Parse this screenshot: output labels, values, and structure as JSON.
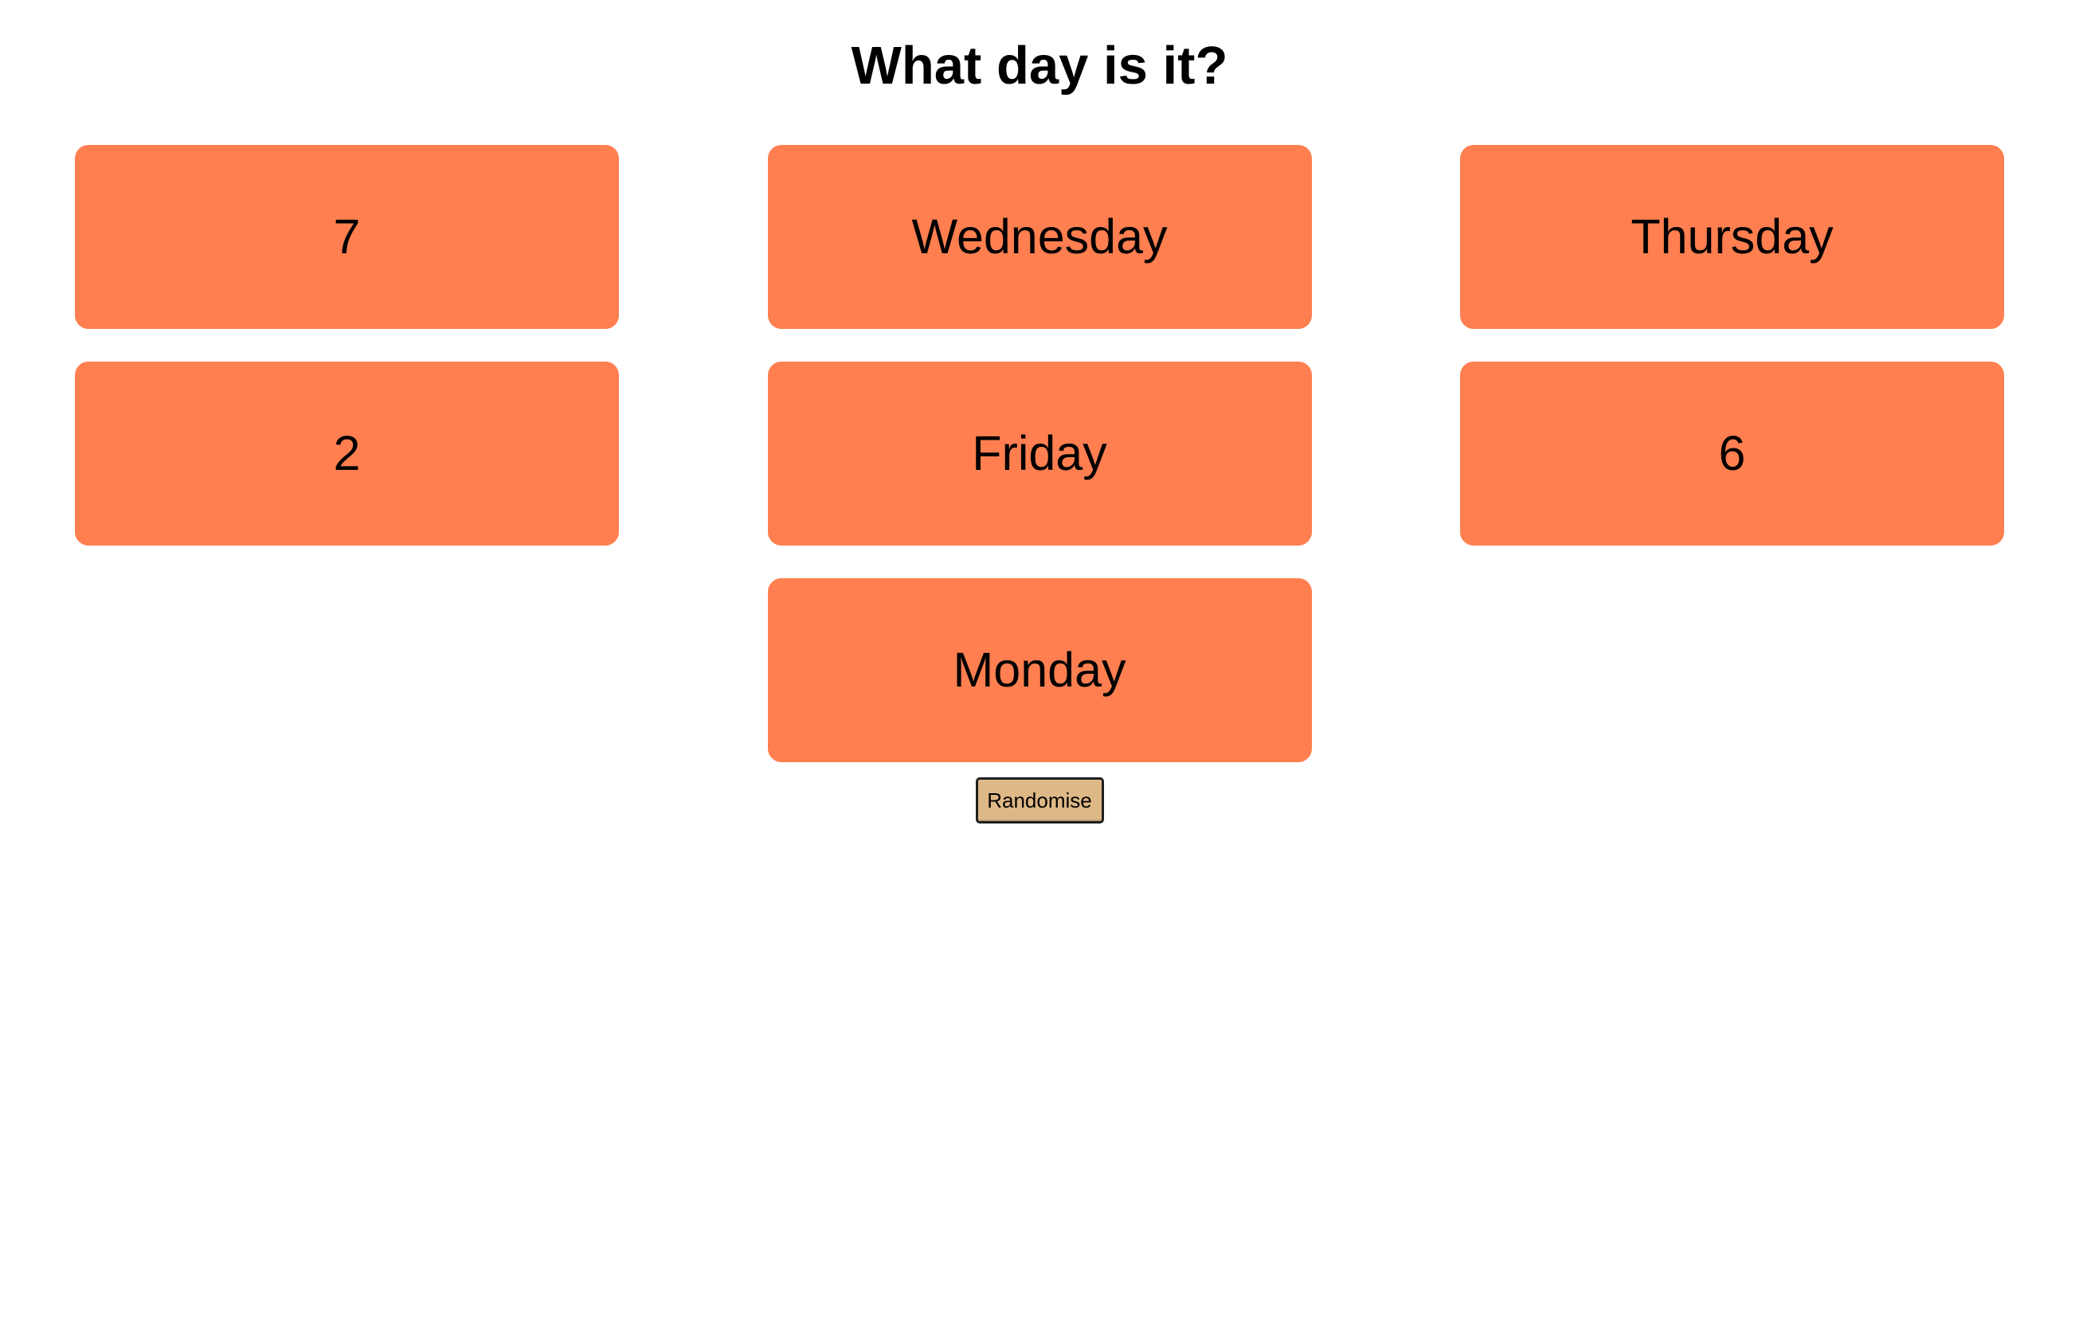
{
  "page": {
    "title": "What day is it?"
  },
  "colors": {
    "card_background": "#FF7F50",
    "button_background": "#DEB887",
    "text": "#000000",
    "page_background": "#FFFFFF"
  },
  "cards": [
    {
      "label": "7"
    },
    {
      "label": "Wednesday"
    },
    {
      "label": "Thursday"
    },
    {
      "label": "2"
    },
    {
      "label": "Friday"
    },
    {
      "label": "6"
    },
    {
      "label": "Monday"
    }
  ],
  "controls": {
    "randomise_label": "Randomise"
  }
}
